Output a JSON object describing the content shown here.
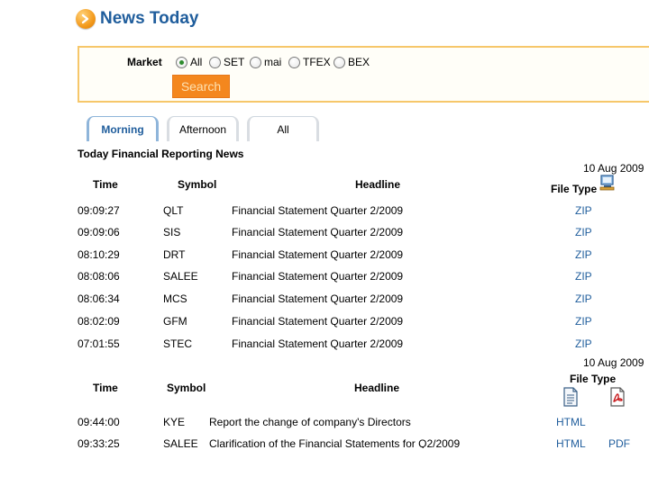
{
  "page": {
    "title": "News Today"
  },
  "search": {
    "market_label": "Market",
    "options": [
      "All",
      "SET",
      "mai",
      "TFEX",
      "BEX"
    ],
    "selected": "All",
    "button_label": "Search"
  },
  "tabs": [
    {
      "label": "Morning",
      "active": true
    },
    {
      "label": "Afternoon",
      "active": false
    },
    {
      "label": "All",
      "active": false
    }
  ],
  "section_title": "Today Financial Reporting News",
  "table1": {
    "date": "10 Aug 2009",
    "headers": {
      "time": "Time",
      "symbol": "Symbol",
      "headline": "Headline",
      "file_type": "File Type"
    },
    "rows": [
      {
        "time": "09:09:27",
        "symbol": "QLT",
        "headline": "Financial Statement Quarter 2/2009",
        "file": "ZIP"
      },
      {
        "time": "09:09:06",
        "symbol": "SIS",
        "headline": "Financial Statement Quarter 2/2009",
        "file": "ZIP"
      },
      {
        "time": "08:10:29",
        "symbol": "DRT",
        "headline": "Financial Statement Quarter 2/2009",
        "file": "ZIP"
      },
      {
        "time": "08:08:06",
        "symbol": "SALEE",
        "headline": "Financial Statement Quarter 2/2009",
        "file": "ZIP"
      },
      {
        "time": "08:06:34",
        "symbol": "MCS",
        "headline": "Financial Statement Quarter 2/2009",
        "file": "ZIP"
      },
      {
        "time": "08:02:09",
        "symbol": "GFM",
        "headline": "Financial Statement Quarter 2/2009",
        "file": "ZIP"
      },
      {
        "time": "07:01:55",
        "symbol": "STEC",
        "headline": "Financial Statement Quarter 2/2009",
        "file": "ZIP"
      }
    ]
  },
  "table2": {
    "date": "10 Aug 2009",
    "headers": {
      "time": "Time",
      "symbol": "Symbol",
      "headline": "Headline",
      "file_type": "File Type"
    },
    "rows": [
      {
        "time": "09:44:00",
        "symbol": "KYE",
        "headline": "Report the change of company's Directors",
        "html": "HTML",
        "pdf": ""
      },
      {
        "time": "09:33:25",
        "symbol": "SALEE",
        "headline": "Clarification of the Financial Statements for Q2/2009",
        "html": "HTML",
        "pdf": "PDF"
      }
    ]
  }
}
